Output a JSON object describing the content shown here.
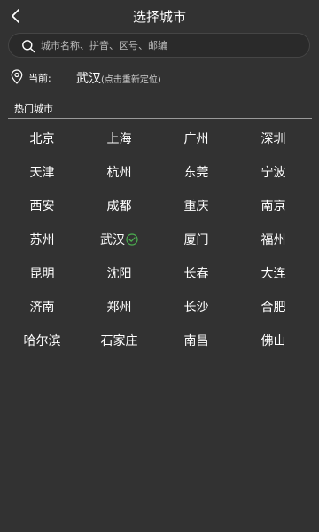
{
  "header": {
    "title": "选择城市",
    "back_icon": "chevron-left-icon"
  },
  "search": {
    "placeholder": "城市名称、拼音、区号、邮编",
    "value": "",
    "icon": "search-icon"
  },
  "location": {
    "label": "当前:",
    "city": "武汉",
    "hint": "(点击重新定位)",
    "icon": "map-pin-icon"
  },
  "hot_cities": {
    "title": "热门城市",
    "selected": "武汉",
    "selected_icon": "check-circle-icon",
    "accent_color": "#4caf50",
    "items": [
      {
        "name": "北京"
      },
      {
        "name": "上海"
      },
      {
        "name": "广州"
      },
      {
        "name": "深圳"
      },
      {
        "name": "天津"
      },
      {
        "name": "杭州"
      },
      {
        "name": "东莞"
      },
      {
        "name": "宁波"
      },
      {
        "name": "西安"
      },
      {
        "name": "成都"
      },
      {
        "name": "重庆"
      },
      {
        "name": "南京"
      },
      {
        "name": "苏州"
      },
      {
        "name": "武汉"
      },
      {
        "name": "厦门"
      },
      {
        "name": "福州"
      },
      {
        "name": "昆明"
      },
      {
        "name": "沈阳"
      },
      {
        "name": "长春"
      },
      {
        "name": "大连"
      },
      {
        "name": "济南"
      },
      {
        "name": "郑州"
      },
      {
        "name": "长沙"
      },
      {
        "name": "合肥"
      },
      {
        "name": "哈尔滨"
      },
      {
        "name": "石家庄"
      },
      {
        "name": "南昌"
      },
      {
        "name": "佛山"
      }
    ]
  }
}
